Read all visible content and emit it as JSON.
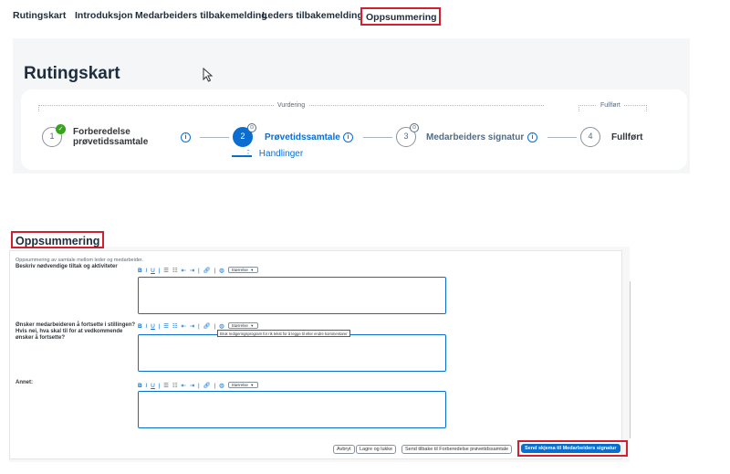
{
  "tabs": [
    {
      "label": "Rutingskart"
    },
    {
      "label": "Introduksjon"
    },
    {
      "label": "Medarbeiders tilbakemelding"
    },
    {
      "label": "Leders tilbakemelding"
    },
    {
      "label": "Oppsummering",
      "active": true
    }
  ],
  "page": {
    "title": "Rutingskart"
  },
  "groups": {
    "vurdering": "Vurdering",
    "fullfort": "Fullført"
  },
  "steps": [
    {
      "number": "1",
      "label_line1": "Forberedelse",
      "label_line2": "prøvetidssamtale",
      "status": "completed"
    },
    {
      "number": "2",
      "label_line1": "Prøvetidssamtale",
      "status": "current"
    },
    {
      "number": "3",
      "label_line1": "Medarbeiders signatur",
      "status": "locked"
    },
    {
      "number": "4",
      "label_line1": "Fullført",
      "status": "pending"
    }
  ],
  "actions_label": "Handlinger",
  "form": {
    "section_title": "Oppsummering",
    "intro": "Oppsummering av samtale mellom leder og medarbeider.",
    "fields": [
      {
        "label": "Beskriv nødvendige tiltak og aktiviteter",
        "value": ""
      },
      {
        "label": "Ønsker medarbeideren å fortsette i stillingen? Hvis nei, hva skal til for at vedkommende ønsker å fortsette?",
        "value": ""
      },
      {
        "label": "Annet:",
        "value": ""
      }
    ],
    "toolbar": {
      "bold": "B",
      "italic": "I",
      "underline": "U",
      "size_label": "Størrelse"
    },
    "tooltip": "Bruk redigeringsprogram for rik tekst for å legge til eller endre kommentarer",
    "buttons": {
      "cancel": "Avbryt",
      "save_close": "Lagre og lukke",
      "send_back": "Send tilbake til Forberedelse prøvetidssamtale",
      "send": "Send skjema til Medarbeiders signatur"
    }
  },
  "colors": {
    "accent": "#0a6ed1",
    "highlight": "#d32030",
    "success": "#36a41d"
  }
}
